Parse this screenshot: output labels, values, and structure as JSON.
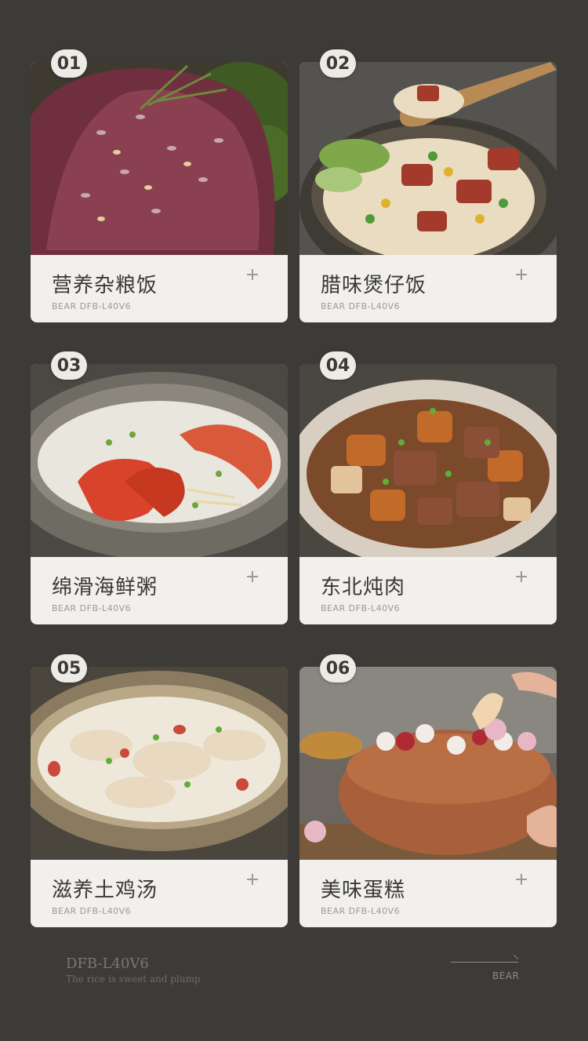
{
  "dishes": [
    {
      "num": "01",
      "title": "营养杂粮饭",
      "model": "BEAR DFB-L40V6"
    },
    {
      "num": "02",
      "title": "腊味煲仔饭",
      "model": "BEAR DFB-L40V6"
    },
    {
      "num": "03",
      "title": "绵滑海鲜粥",
      "model": "BEAR DFB-L40V6"
    },
    {
      "num": "04",
      "title": "东北炖肉",
      "model": "BEAR DFB-L40V6"
    },
    {
      "num": "05",
      "title": "滋养土鸡汤",
      "model": "BEAR DFB-L40V6"
    },
    {
      "num": "06",
      "title": "美味蛋糕",
      "model": "BEAR DFB-L40V6"
    }
  ],
  "footer": {
    "model": "DFB-L40V6",
    "slogan": "The rice is sweet and plump",
    "brand": "BEAR"
  },
  "icons": {
    "expand": "plus-icon",
    "arrow": "arrow-line-icon"
  },
  "colors": {
    "background": "#3d3b37",
    "card": "#f1f0ec",
    "text": "#3a3935"
  }
}
